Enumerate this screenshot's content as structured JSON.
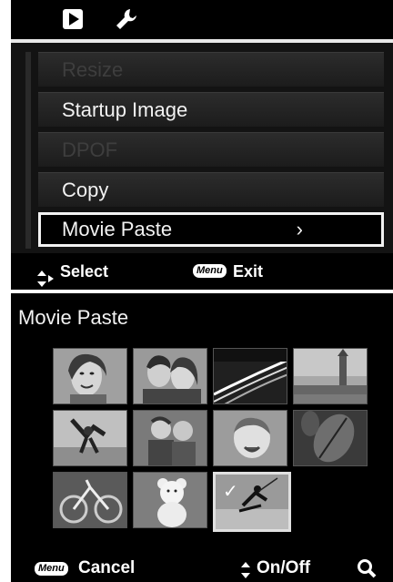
{
  "menu_screen": {
    "tabs": [
      {
        "name": "playback",
        "icon": "play-icon",
        "active": true
      },
      {
        "name": "setup",
        "icon": "wrench-icon",
        "active": false
      }
    ],
    "items": [
      {
        "label": "Resize",
        "enabled": false,
        "selected": false
      },
      {
        "label": "Startup Image",
        "enabled": true,
        "selected": false
      },
      {
        "label": "DPOF",
        "enabled": false,
        "selected": false
      },
      {
        "label": "Copy",
        "enabled": true,
        "selected": false
      },
      {
        "label": "Movie Paste",
        "enabled": true,
        "selected": true,
        "arrow": "›"
      }
    ],
    "hints": {
      "select_label": "Select",
      "menu_badge": "Menu",
      "exit_label": "Exit"
    }
  },
  "paste_screen": {
    "title": "Movie Paste",
    "thumbnails": [
      {
        "subject": "woman portrait",
        "checked": false
      },
      {
        "subject": "couple",
        "checked": false
      },
      {
        "subject": "night highway",
        "checked": false
      },
      {
        "subject": "big ben",
        "checked": false
      },
      {
        "subject": "beach jump",
        "checked": false
      },
      {
        "subject": "two children",
        "checked": false
      },
      {
        "subject": "crying baby",
        "checked": false
      },
      {
        "subject": "leaves",
        "checked": false
      },
      {
        "subject": "bicycle",
        "checked": false
      },
      {
        "subject": "teddy bear",
        "checked": false
      },
      {
        "subject": "kite surfer",
        "checked": true
      }
    ],
    "check_mark": "✓",
    "hints": {
      "menu_badge": "Menu",
      "cancel_label": "Cancel",
      "onoff_label": "On/Off"
    }
  }
}
